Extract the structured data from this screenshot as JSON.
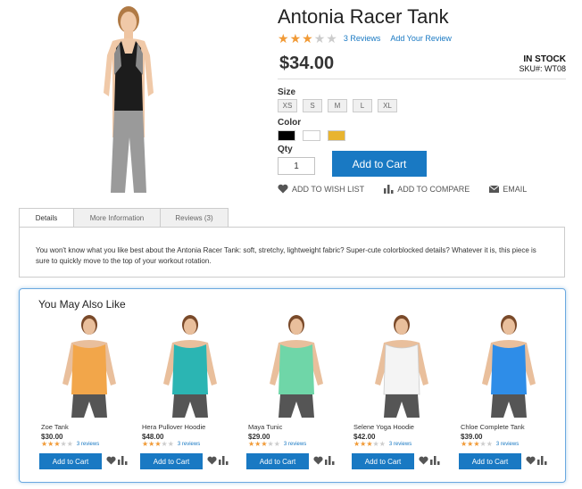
{
  "product": {
    "title": "Antonia Racer Tank",
    "rating": 3,
    "reviews_link": "3 Reviews",
    "add_review_link": "Add Your Review",
    "price": "$34.00",
    "stock": "IN STOCK",
    "sku": "SKU#: WT08"
  },
  "options": {
    "size_label": "Size",
    "sizes": [
      "XS",
      "S",
      "M",
      "L",
      "XL"
    ],
    "color_label": "Color",
    "colors": [
      "#000000",
      "#ffffff",
      "#e8b430"
    ],
    "qty_label": "Qty",
    "qty_value": "1",
    "add_to_cart": "Add to Cart"
  },
  "actions": {
    "wishlist": "ADD TO WISH LIST",
    "compare": "ADD TO COMPARE",
    "email": "EMAIL"
  },
  "tabs": {
    "items": [
      "Details",
      "More Information",
      "Reviews (3)"
    ],
    "active": "Details",
    "details_text": "You won't know what you like best about the Antonia Racer Tank: soft, stretchy, lightweight fabric? Super-cute colorblocked details? Whatever it is, this piece is sure to quickly move to the top of your workout rotation."
  },
  "related": {
    "title": "You May Also Like",
    "button": "Add to Cart",
    "items": [
      {
        "name": "Zoe Tank",
        "price": "$30.00",
        "rating": 3,
        "reviews": "3 reviews",
        "color": "#f2a64a"
      },
      {
        "name": "Hera Pullover Hoodie",
        "price": "$48.00",
        "rating": 3,
        "reviews": "3 reviews",
        "color": "#2bb5b3"
      },
      {
        "name": "Maya Tunic",
        "price": "$29.00",
        "rating": 3,
        "reviews": "3 reviews",
        "color": "#6fd6a8"
      },
      {
        "name": "Selene Yoga Hoodie",
        "price": "$42.00",
        "rating": 3,
        "reviews": "3 reviews",
        "color": "#f4f4f4"
      },
      {
        "name": "Chloe Complete Tank",
        "price": "$39.00",
        "rating": 3,
        "reviews": "3 reviews",
        "color": "#2e8de8"
      }
    ]
  },
  "colors": {
    "accent": "#1979c3",
    "star": "#f19a36"
  }
}
